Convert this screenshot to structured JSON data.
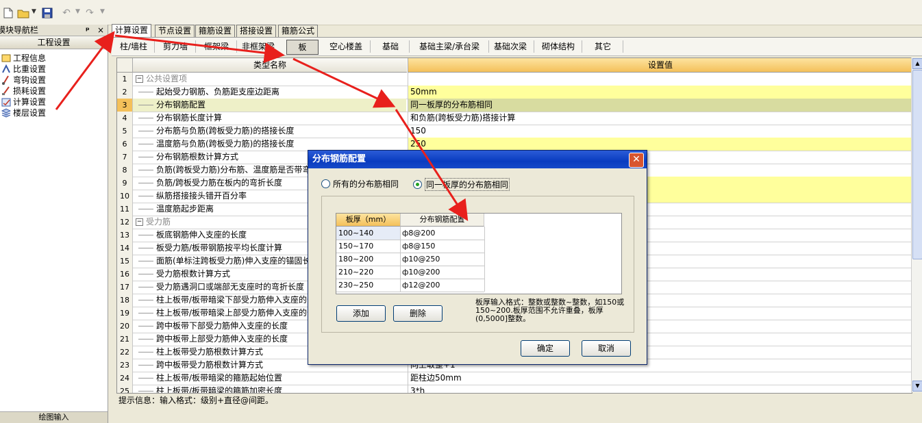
{
  "nav": {
    "title": "模块导航栏",
    "pin": "ᵖ",
    "close": "×",
    "section": "工程设置",
    "items": [
      "工程信息",
      "比重设置",
      "弯钩设置",
      "损耗设置",
      "计算设置",
      "楼层设置"
    ],
    "bottom": "绘图输入"
  },
  "tabs": [
    "计算设置",
    "节点设置",
    "箍筋设置",
    "搭接设置",
    "箍筋公式"
  ],
  "subtabs": [
    "柱/墙柱",
    "剪力墙",
    "框架梁",
    "非框架梁",
    "板",
    "空心楼盖",
    "基础",
    "基础主梁/承台梁",
    "基础次梁",
    "砌体结构",
    "其它"
  ],
  "grid": {
    "col_name": "类型名称",
    "col_value": "设置值",
    "rows": [
      {
        "n": "1",
        "name": "公共设置项",
        "value": "",
        "group": true
      },
      {
        "n": "2",
        "name": "起始受力钢筋、负筋距支座边距离",
        "value": "50mm"
      },
      {
        "n": "3",
        "name": "分布钢筋配置",
        "value": "同一板厚的分布筋相同"
      },
      {
        "n": "4",
        "name": "分布钢筋长度计算",
        "value": "和负筋(跨板受力筋)搭接计算"
      },
      {
        "n": "5",
        "name": "分布筋与负筋(跨板受力筋)的搭接长度",
        "value": "150"
      },
      {
        "n": "6",
        "name": "温度筋与负筋(跨板受力筋)的搭接长度",
        "value": "250"
      },
      {
        "n": "7",
        "name": "分布钢筋根数计算方式",
        "value": ""
      },
      {
        "n": "8",
        "name": "负筋(跨板受力筋)分布筋、温度筋是否带弯",
        "value": ""
      },
      {
        "n": "9",
        "name": "负筋/跨板受力筋在板内的弯折长度",
        "value": ""
      },
      {
        "n": "10",
        "name": "纵筋搭接接头错开百分率",
        "value": ""
      },
      {
        "n": "11",
        "name": "温度筋起步距离",
        "value": ""
      },
      {
        "n": "12",
        "name": "受力筋",
        "value": "",
        "group": true
      },
      {
        "n": "13",
        "name": "板底钢筋伸入支座的长度",
        "value": ""
      },
      {
        "n": "14",
        "name": "板受力筋/板带钢筋按平均长度计算",
        "value": ""
      },
      {
        "n": "15",
        "name": "面筋(单标注跨板受力筋)伸入支座的锚固长",
        "value": ""
      },
      {
        "n": "16",
        "name": "受力筋根数计算方式",
        "value": ""
      },
      {
        "n": "17",
        "name": "受力筋遇洞口或端部无支座时的弯折长度",
        "value": ""
      },
      {
        "n": "18",
        "name": "柱上板带/板带暗梁下部受力筋伸入支座的长",
        "value": ""
      },
      {
        "n": "19",
        "name": "柱上板带/板带暗梁上部受力筋伸入支座的长",
        "value": ""
      },
      {
        "n": "20",
        "name": "跨中板带下部受力筋伸入支座的长度",
        "value": ""
      },
      {
        "n": "21",
        "name": "跨中板带上部受力筋伸入支座的长度",
        "value": ""
      },
      {
        "n": "22",
        "name": "柱上板带受力筋根数计算方式",
        "value": ""
      },
      {
        "n": "23",
        "name": "跨中板带受力筋根数计算方式",
        "value": "向上取整+1"
      },
      {
        "n": "24",
        "name": "柱上板带/板带暗梁的箍筋起始位置",
        "value": "距柱边50mm"
      },
      {
        "n": "25",
        "name": "柱上板带/板带暗梁的箍筋加密长度",
        "value": "3*h"
      }
    ]
  },
  "status": "提示信息：输入格式：级别+直径@间距。",
  "dialog": {
    "title": "分布钢筋配置",
    "radio_all": "所有的分布筋相同",
    "radio_same": "同一板厚的分布筋相同",
    "col1": "板厚（mm）",
    "col2": "分布钢筋配置",
    "rows": [
      {
        "t": "100~140",
        "c": "ф8@200"
      },
      {
        "t": "150~170",
        "c": "ф8@150"
      },
      {
        "t": "180~200",
        "c": "ф10@250"
      },
      {
        "t": "210~220",
        "c": "ф10@200"
      },
      {
        "t": "230~250",
        "c": "ф12@200"
      }
    ],
    "add": "添加",
    "delete": "删除",
    "hint": "板厚输入格式：整数或整数~整数，如150或150~200.板厚范围不允许重叠，板厚(0,5000]整数。",
    "ok": "确定",
    "cancel": "取消"
  }
}
